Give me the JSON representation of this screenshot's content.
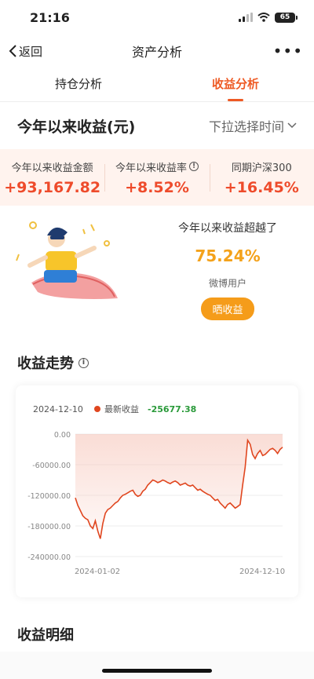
{
  "status": {
    "time": "21:16",
    "battery": "65"
  },
  "nav": {
    "back_label": "返回",
    "title": "资产分析",
    "more": "•••"
  },
  "tabs": [
    {
      "label": "持仓分析",
      "active": false
    },
    {
      "label": "收益分析",
      "active": true
    }
  ],
  "period": {
    "title": "今年以来收益(元)",
    "select_label": "下拉选择时间"
  },
  "stats": [
    {
      "label": "今年以来收益金额",
      "value": "+93,167.82",
      "has_info": false
    },
    {
      "label": "今年以来收益率",
      "value": "+8.52%",
      "has_info": true
    },
    {
      "label": "同期沪深300",
      "value": "+16.45%",
      "has_info": false
    }
  ],
  "beat": {
    "label": "今年以来收益超越了",
    "value": "75.24%",
    "user": "微博用户",
    "share_label": "晒收益"
  },
  "trend": {
    "title": "收益走势"
  },
  "detail": {
    "title": "收益明细"
  },
  "colors": {
    "accent": "#ee5a24",
    "positive": "#ee4b2b",
    "gold": "#f4a21b",
    "legend_value": "#2a9a3a"
  },
  "chart_data": {
    "type": "area",
    "legend_date": "2024-12-10",
    "legend_label": "最新收益",
    "legend_value": "-25677.38",
    "x_labels": [
      "2024-01-02",
      "2024-12-10"
    ],
    "y_ticks": [
      "0.00",
      "-60000.00",
      "-120000.00",
      "-180000.00",
      "-240000.00"
    ],
    "ylim": [
      -240000,
      0
    ],
    "series": [
      {
        "values": [
          -125000,
          -140000,
          -150000,
          -160000,
          -165000,
          -168000,
          -180000,
          -185000,
          -170000,
          -190000,
          -205000,
          -175000,
          -155000,
          -148000,
          -145000,
          -140000,
          -135000,
          -132000,
          -125000,
          -120000,
          -118000,
          -115000,
          -112000,
          -110000,
          -118000,
          -122000,
          -120000,
          -112000,
          -108000,
          -100000,
          -95000,
          -90000,
          -92000,
          -95000,
          -93000,
          -90000,
          -92000,
          -95000,
          -97000,
          -94000,
          -92000,
          -95000,
          -100000,
          -98000,
          -96000,
          -100000,
          -102000,
          -100000,
          -105000,
          -110000,
          -108000,
          -112000,
          -115000,
          -118000,
          -120000,
          -125000,
          -130000,
          -128000,
          -135000,
          -140000,
          -145000,
          -138000,
          -135000,
          -140000,
          -145000,
          -142000,
          -138000,
          -100000,
          -65000,
          -12000,
          -20000,
          -40000,
          -48000,
          -38000,
          -32000,
          -42000,
          -40000,
          -35000,
          -30000,
          -28000,
          -32000,
          -38000,
          -30000,
          -25677
        ]
      }
    ]
  }
}
